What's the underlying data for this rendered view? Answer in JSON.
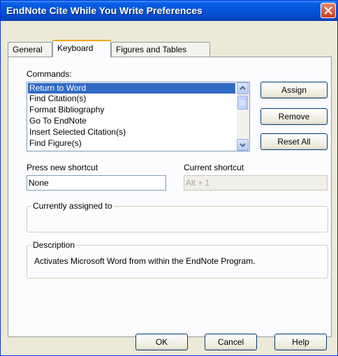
{
  "window": {
    "title": "EndNote Cite While You Write Preferences"
  },
  "tabs": [
    {
      "label": "General"
    },
    {
      "label": "Keyboard"
    },
    {
      "label": "Figures and Tables"
    }
  ],
  "commands": {
    "label": "Commands:",
    "items": [
      "Return to Word",
      "Find Citation(s)",
      "Format Bibliography",
      "Go To EndNote",
      "Insert Selected Citation(s)",
      "Find Figure(s)"
    ],
    "selected": "Return to Word"
  },
  "buttons": {
    "assign": "Assign",
    "remove": "Remove",
    "reset_all": "Reset All"
  },
  "shortcut": {
    "new_label": "Press new shortcut",
    "new_value": "None",
    "current_label": "Current shortcut",
    "current_value": "Alt + 1"
  },
  "assigned": {
    "legend": "Currently assigned to",
    "value": ""
  },
  "description": {
    "legend": "Description",
    "text": "Activates Microsoft Word from within the EndNote Program."
  },
  "footer": {
    "ok": "OK",
    "cancel": "Cancel",
    "help": "Help"
  },
  "colors": {
    "title_bar": "#0553d6",
    "selection": "#316ac5",
    "tab_highlight": "#f7a300"
  }
}
